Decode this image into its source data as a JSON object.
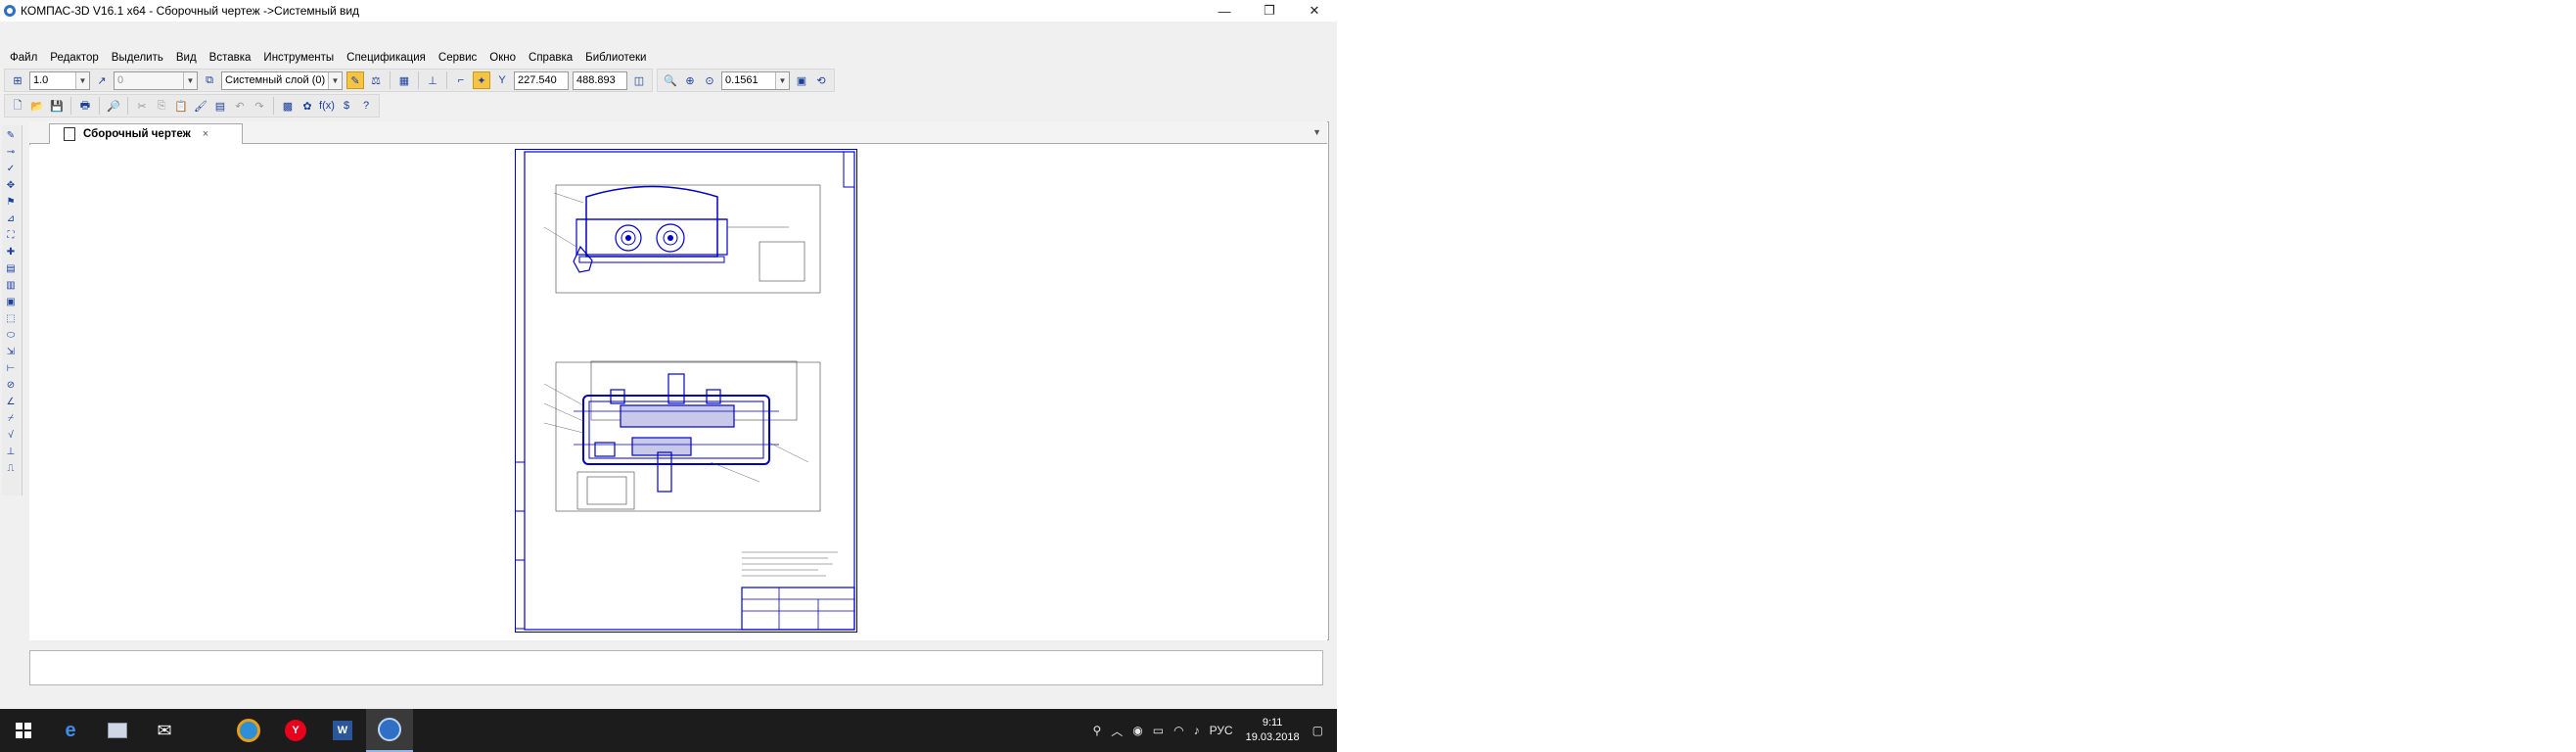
{
  "window": {
    "title": "КОМПАС-3D V16.1 x64 - Сборочный чертеж ->Системный вид",
    "minimize_glyph": "—",
    "maximize_glyph": "❐",
    "close_glyph": "✕"
  },
  "menu": [
    "Файл",
    "Редактор",
    "Выделить",
    "Вид",
    "Вставка",
    "Инструменты",
    "Спецификация",
    "Сервис",
    "Окно",
    "Справка",
    "Библиотеки"
  ],
  "toolbar1": {
    "scale": "1.0",
    "step": "0",
    "layer": "Системный слой (0)",
    "coord_x": "227.540",
    "coord_y": "488.893",
    "zoom": "0.1561",
    "y_label": "Y"
  },
  "tab": {
    "label": "Сборочный чертеж",
    "close": "×"
  },
  "taskbar": {
    "lang": "РУС",
    "time": "9:11",
    "date": "19.03.2018"
  },
  "icons": [
    "windows-start-icon",
    "edge-icon",
    "file-explorer-icon",
    "mail-icon",
    "chrome-icon",
    "yandex-icon",
    "word-icon",
    "kompas-icon"
  ]
}
